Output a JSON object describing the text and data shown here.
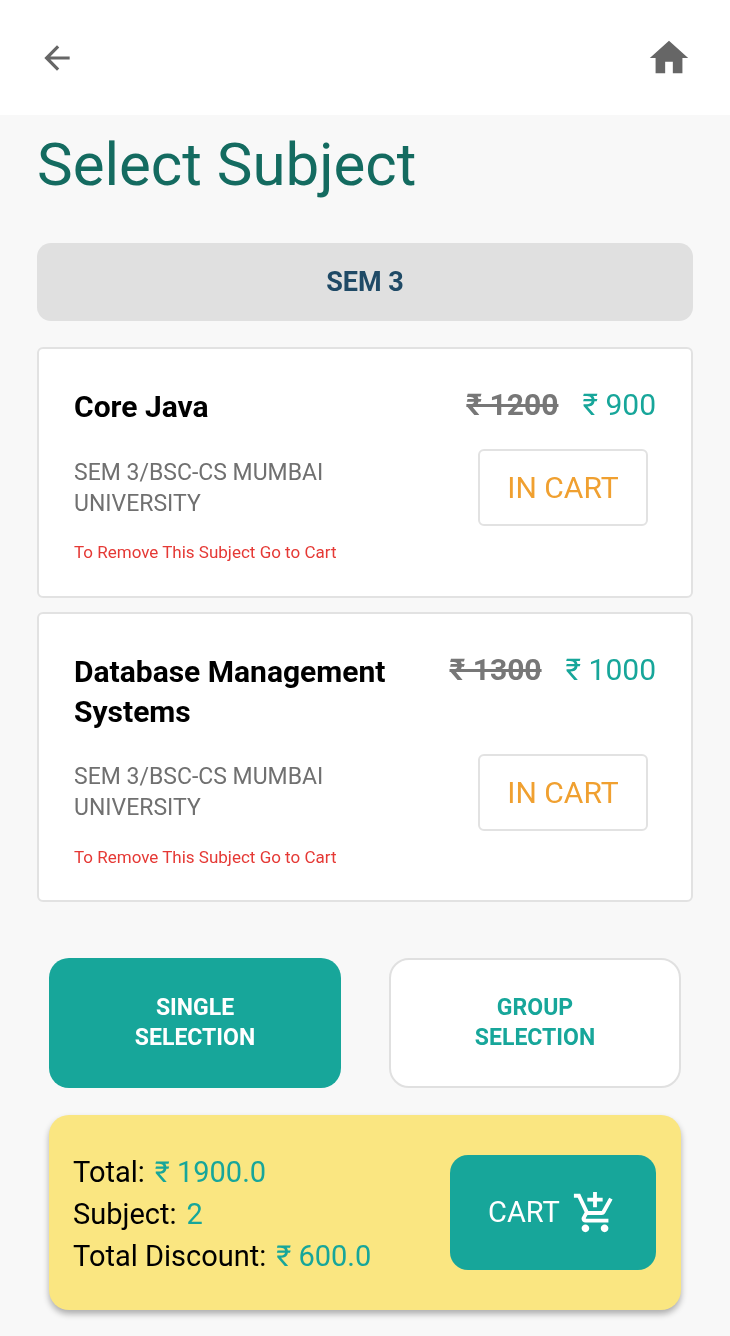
{
  "title": "Select Subject",
  "semester": "SEM 3",
  "subjects": [
    {
      "name": "Core Java",
      "old_price": "₹ 1200",
      "price": "₹ 900",
      "details": "SEM 3/BSC-CS  MUMBAI UNIVERSITY",
      "status": "IN CART",
      "note": "To Remove This Subject Go to Cart"
    },
    {
      "name": "Database Management Systems",
      "old_price": "₹ 1300",
      "price": "₹ 1000",
      "details": "SEM 3/BSC-CS  MUMBAI UNIVERSITY",
      "status": "IN CART",
      "note": "To Remove This Subject Go to Cart"
    }
  ],
  "selection_modes": [
    {
      "label": "SINGLE SELECTION",
      "selected": true
    },
    {
      "label": "GROUP SELECTION",
      "selected": false
    }
  ],
  "summary": {
    "total_label": "Total:",
    "total": "₹ 1900.0",
    "subject_label": "Subject:",
    "subject_count": "2",
    "discount_label": "Total Discount:",
    "discount": "₹ 600.0"
  },
  "cart_button": "CART"
}
